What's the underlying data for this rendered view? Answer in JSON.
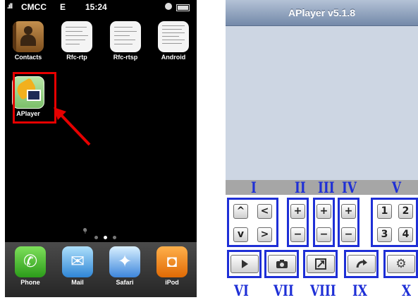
{
  "phone": {
    "status": {
      "signal": ".ıll",
      "carrier": "CMCC",
      "network": "E",
      "time": "15:24"
    },
    "apps": [
      {
        "label": "Contacts",
        "icon": "contacts-icon"
      },
      {
        "label": "Rfc-rtp",
        "icon": "document-icon"
      },
      {
        "label": "Rfc-rtsp",
        "icon": "document-icon"
      },
      {
        "label": "Android",
        "icon": "document-icon"
      },
      {
        "label": "APlayer",
        "icon": "aplayer-icon"
      }
    ],
    "dock": [
      {
        "label": "Phone",
        "icon": "phone-icon"
      },
      {
        "label": "Mail",
        "icon": "mail-icon"
      },
      {
        "label": "Safari",
        "icon": "safari-icon"
      },
      {
        "label": "iPod",
        "icon": "ipod-icon"
      }
    ],
    "page_indicator": {
      "pages": 3,
      "active": 2
    },
    "highlight_color": "#e60000"
  },
  "player": {
    "title": "APlayer v5.1.8",
    "nav_buttons": [
      "^",
      "<",
      "v",
      ">"
    ],
    "zoom_buttons": [
      "+",
      "−"
    ],
    "volume_buttons": [
      "+",
      "−"
    ],
    "brightness_buttons": [
      "+",
      "−"
    ],
    "number_buttons": [
      "1",
      "2",
      "3",
      "4"
    ],
    "bottom_icons": [
      "play-icon",
      "camera-icon",
      "fullscreen-icon",
      "rotate-icon",
      "settings-icon"
    ],
    "group_labels": [
      "I",
      "II",
      "III",
      "IV",
      "V",
      "VI",
      "VII",
      "VIII",
      "IX",
      "X"
    ],
    "annotation_color": "#1e2fd6"
  }
}
